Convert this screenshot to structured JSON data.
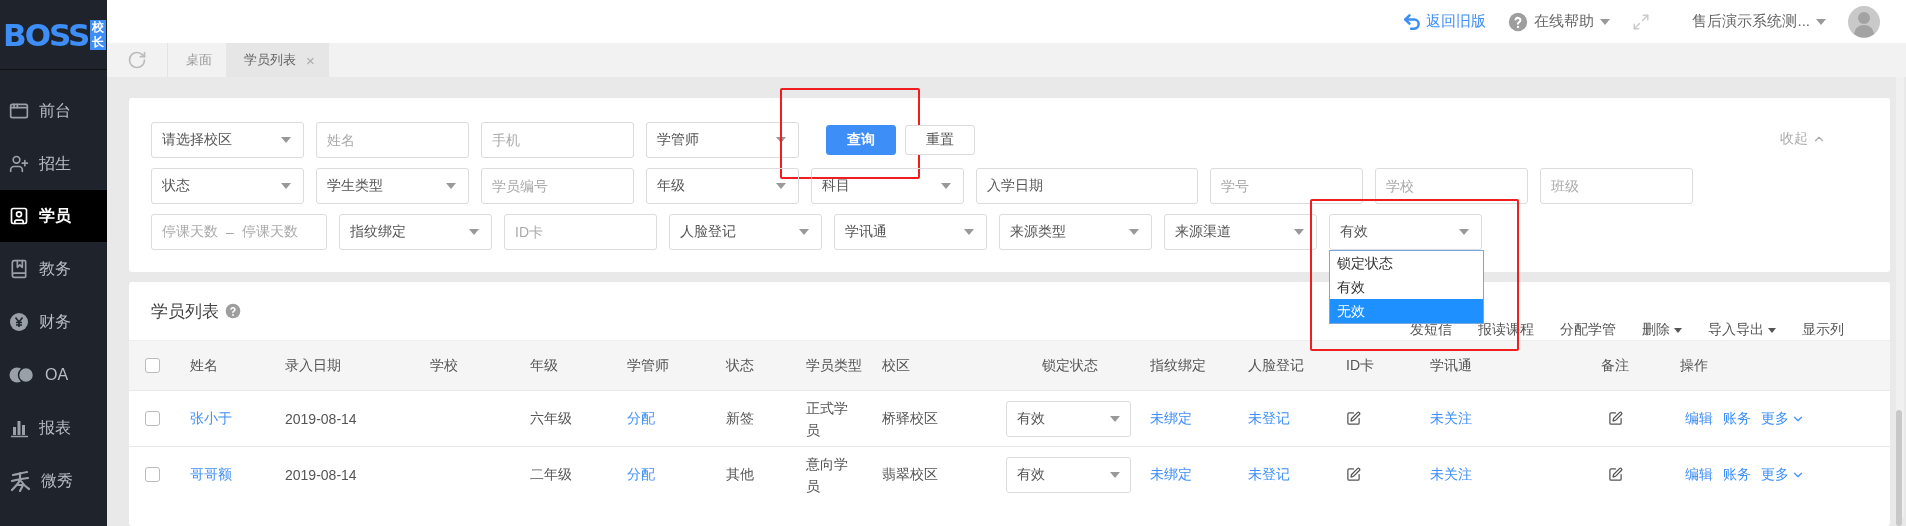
{
  "logo": {
    "text": "BOSS",
    "badge": "校长"
  },
  "sidebar": {
    "items": [
      {
        "label": "前台",
        "selected": false
      },
      {
        "label": "招生",
        "selected": false
      },
      {
        "label": "学员",
        "selected": true
      },
      {
        "label": "教务",
        "selected": false
      },
      {
        "label": "财务",
        "selected": false
      },
      {
        "label": "OA",
        "selected": false
      },
      {
        "label": "报表",
        "selected": false
      },
      {
        "label": "微秀",
        "selected": false
      }
    ]
  },
  "topbar": {
    "back_link": "返回旧版",
    "help": "在线帮助",
    "account": "售后演示系统测..."
  },
  "tabs": [
    {
      "label": "桌面",
      "selected": false
    },
    {
      "label": "学员列表",
      "selected": true,
      "close": "×"
    }
  ],
  "filters": {
    "collapse": "收起",
    "rows": [
      [
        {
          "kind": "select",
          "label": "请选择校区"
        },
        {
          "kind": "input",
          "placeholder": "姓名"
        },
        {
          "kind": "input",
          "placeholder": "手机"
        },
        {
          "kind": "select",
          "label": "学管师"
        },
        {
          "kind": "button",
          "label": "查询",
          "primary": true,
          "highlighted": true
        },
        {
          "kind": "button",
          "label": "重置",
          "primary": false
        }
      ],
      [
        {
          "kind": "select",
          "label": "状态"
        },
        {
          "kind": "select",
          "label": "学生类型"
        },
        {
          "kind": "input",
          "placeholder": "学员编号"
        },
        {
          "kind": "select",
          "label": "年级"
        },
        {
          "kind": "select",
          "label": "科目"
        },
        {
          "kind": "date",
          "label": "入学日期"
        },
        {
          "kind": "input",
          "placeholder": "学号"
        },
        {
          "kind": "input",
          "placeholder": "学校"
        },
        {
          "kind": "input",
          "placeholder": "班级"
        }
      ],
      [
        {
          "kind": "range",
          "placeholder_from": "停课天数",
          "separator": "–",
          "placeholder_to": "停课天数"
        },
        {
          "kind": "select",
          "label": "指纹绑定"
        },
        {
          "kind": "input",
          "placeholder": "ID卡"
        },
        {
          "kind": "select",
          "label": "人脸登记"
        },
        {
          "kind": "select",
          "label": "学讯通"
        },
        {
          "kind": "select",
          "label": "来源类型"
        },
        {
          "kind": "select",
          "label": "来源渠道"
        },
        {
          "kind": "select",
          "label": "有效",
          "expanded": true,
          "highlighted": true,
          "options": [
            {
              "label": "锁定状态",
              "selected": false
            },
            {
              "label": "有效",
              "selected": false
            },
            {
              "label": "无效",
              "selected": true
            }
          ]
        }
      ]
    ]
  },
  "list": {
    "title": "学员列表",
    "actions": [
      {
        "label": "发短信",
        "menu": false
      },
      {
        "label": "报读课程",
        "menu": false
      },
      {
        "label": "分配学管",
        "menu": false
      },
      {
        "label": "删除",
        "menu": true
      },
      {
        "label": "导入导出",
        "menu": true
      },
      {
        "label": "显示列",
        "menu": false
      }
    ],
    "columns": [
      "姓名",
      "录入日期",
      "学校",
      "年级",
      "学管师",
      "状态",
      "学员类型",
      "校区",
      "锁定状态",
      "指纹绑定",
      "人脸登记",
      "ID卡",
      "学讯通",
      "备注",
      "操作"
    ],
    "all_checked": false,
    "rows": [
      {
        "checked": false,
        "name": "张小于",
        "entry_date": "2019-08-14",
        "grade": "六年级",
        "manager": "分配",
        "status": "新签",
        "type": "正式学员",
        "campus": "桥驿校区",
        "lock": "有效",
        "fingerprint": "未绑定",
        "face": "未登记",
        "xuexuntong": "未关注",
        "actions": [
          "编辑",
          "账务",
          "更多"
        ]
      },
      {
        "checked": false,
        "name": "哥哥额",
        "entry_date": "2019-08-14",
        "grade": "二年级",
        "manager": "分配",
        "status": "其他",
        "type": "意向学员",
        "campus": "翡翠校区",
        "lock": "有效",
        "fingerprint": "未绑定",
        "face": "未登记",
        "xuexuntong": "未关注",
        "actions": [
          "编辑",
          "账务",
          "更多"
        ]
      }
    ]
  }
}
